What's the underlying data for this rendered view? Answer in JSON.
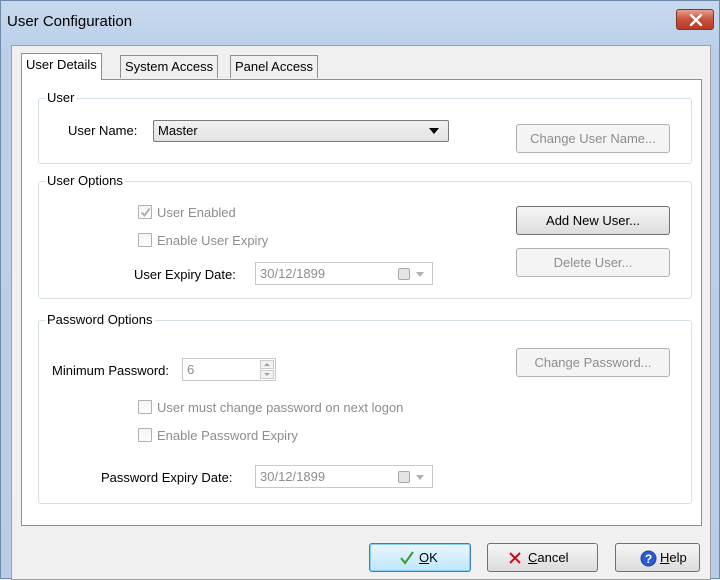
{
  "window": {
    "title": "User Configuration"
  },
  "tabs": [
    {
      "label": "User Details",
      "active": true
    },
    {
      "label": "System Access",
      "active": false
    },
    {
      "label": "Panel Access",
      "active": false
    }
  ],
  "user_group": {
    "legend": "User",
    "user_name_label": "User Name:",
    "user_name_value": "Master",
    "change_user_name_button": "Change User Name..."
  },
  "user_options": {
    "legend": "User Options",
    "user_enabled_label": "User Enabled",
    "user_enabled_checked": true,
    "enable_user_expiry_label": "Enable User Expiry",
    "enable_user_expiry_checked": false,
    "user_expiry_date_label": "User Expiry Date:",
    "user_expiry_date_value": "30/12/1899",
    "add_new_user_button": "Add New User...",
    "delete_user_button": "Delete User..."
  },
  "password_options": {
    "legend": "Password Options",
    "minimum_password_label": "Minimum Password:",
    "minimum_password_value": "6",
    "change_password_button": "Change Password...",
    "must_change_label": "User must change password on next logon",
    "must_change_checked": false,
    "enable_password_expiry_label": "Enable Password Expiry",
    "enable_password_expiry_checked": false,
    "password_expiry_date_label": "Password Expiry Date:",
    "password_expiry_date_value": "30/12/1899"
  },
  "footer": {
    "ok_accel": "O",
    "ok_rest": "K",
    "cancel_accel": "C",
    "cancel_rest": "ancel",
    "help_accel": "H",
    "help_rest": "elp"
  },
  "colors": {
    "ok_check": "#3a9b2c",
    "cancel_x": "#c4121b",
    "help_icon": "#2a5bd0"
  }
}
